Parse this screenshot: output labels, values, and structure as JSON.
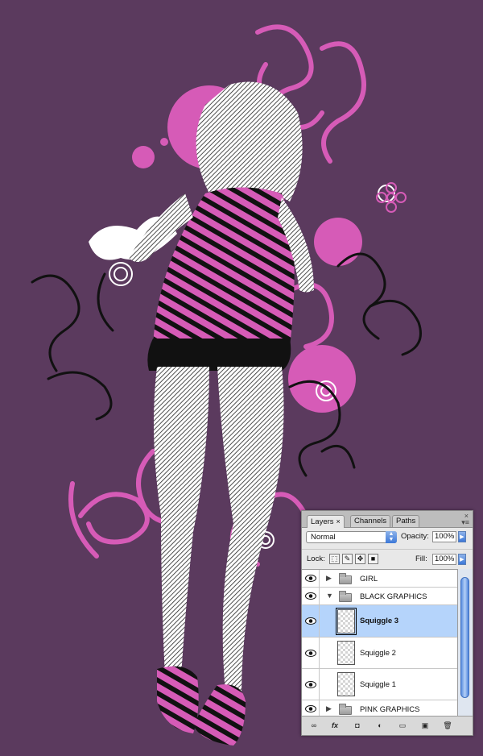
{
  "panel": {
    "tabs": [
      {
        "label": "Layers",
        "close": "×"
      },
      {
        "label": "Channels"
      },
      {
        "label": "Paths"
      }
    ],
    "close_glyph": "×",
    "menu_glyph": "▾≡",
    "blend_mode": "Normal",
    "opacity_label": "Opacity:",
    "opacity_value": "100%",
    "lock_label": "Lock:",
    "fill_label": "Fill:",
    "fill_value": "100%",
    "layers": [
      {
        "name": "GIRL",
        "type": "group",
        "expanded": false,
        "visible": true
      },
      {
        "name": "BLACK GRAPHICS",
        "type": "group",
        "expanded": true,
        "visible": true
      },
      {
        "name": "Squiggle 3",
        "type": "layer",
        "selected": true,
        "visible": true
      },
      {
        "name": "Squiggle 2",
        "type": "layer",
        "selected": false,
        "visible": true
      },
      {
        "name": "Squiggle 1",
        "type": "layer",
        "selected": false,
        "visible": true
      },
      {
        "name": "PINK GRAPHICS",
        "type": "group",
        "expanded": false,
        "visible": true
      }
    ],
    "footer_icons": [
      "link-icon",
      "fx-icon",
      "mask-icon",
      "adjustment-icon",
      "new-group-icon",
      "new-layer-icon",
      "trash-icon"
    ],
    "footer_glyphs": [
      "∞",
      "fx",
      "◘",
      "◐",
      "▭",
      "▣",
      "🗑"
    ]
  },
  "colors": {
    "background": "#5b3a5e",
    "pink": "#d65bb7",
    "selection": "#b5d4fb"
  }
}
